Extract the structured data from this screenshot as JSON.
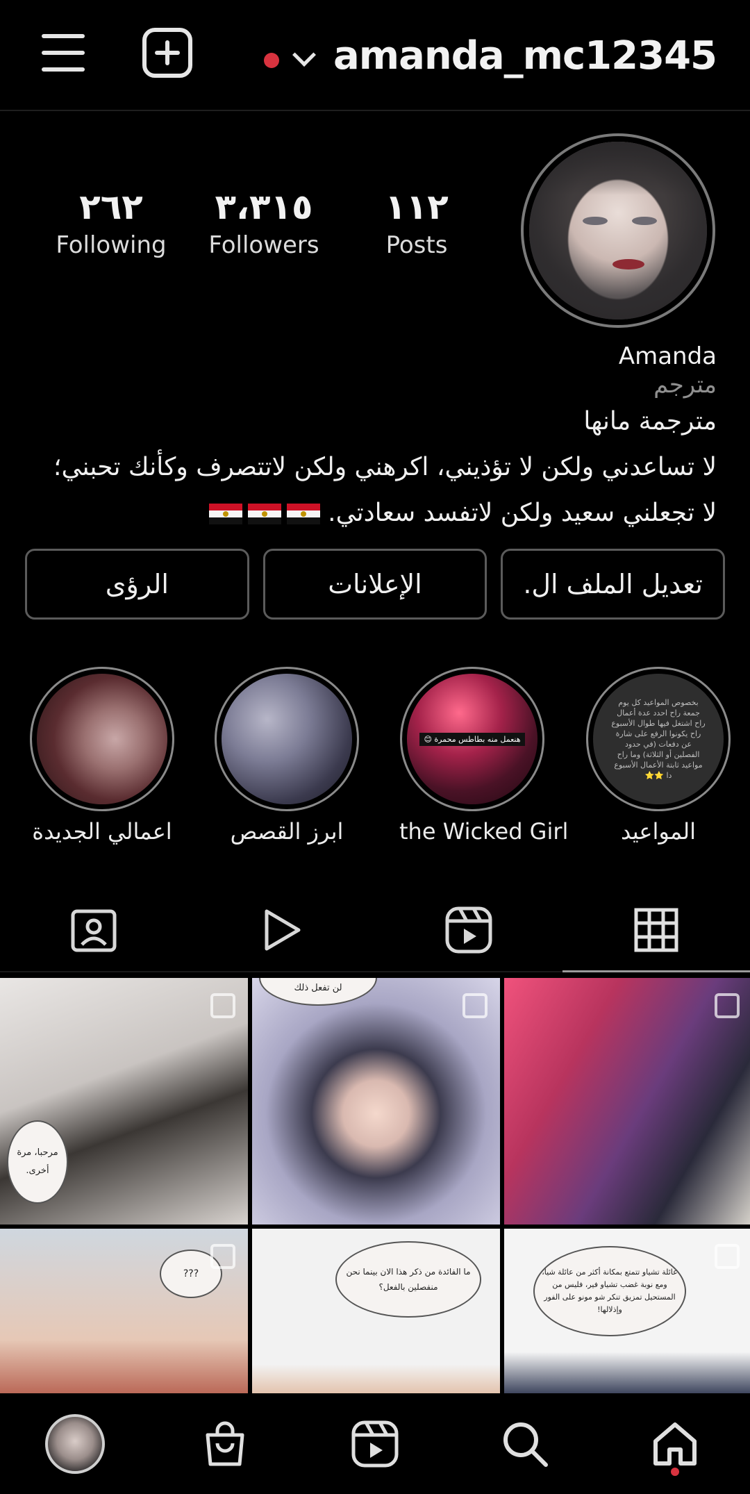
{
  "header": {
    "username": "amanda_mc12345"
  },
  "profile": {
    "stats": [
      {
        "value": "٢٦٢",
        "label": "Following"
      },
      {
        "value": "٣،٣١٥",
        "label": "Followers"
      },
      {
        "value": "١١٢",
        "label": "Posts"
      }
    ],
    "name": "Amanda",
    "category": "مترجم",
    "bio_lines": [
      "مترجمة مانها",
      "لا تساعدني ولكن لا تؤذيني، اكرهني ولكن لاتتصرف وكأنك تحبني؛",
      "لا تجعلني سعيد ولكن لاتفسد سعادتي."
    ]
  },
  "actions": {
    "edit_profile": "تعديل الملف ال.",
    "ads": "الإعلانات",
    "insights": "الرؤى"
  },
  "highlights": [
    {
      "label": "المواعيد",
      "text": "بخصوص المواعيد كل يوم جمعة راح احدد عدة أعمال راح اشتغل فيها طوال الأسبوع راح يكونوا الرفع على شارة عن دفعات (في حدود الفصلين أو الثلاثة) وما راح مواعيد ثابتة الأعمال الأسبوع دا ⭐⭐"
    },
    {
      "label": "the Wicked Girl",
      "text": "هنعمل منه بطاطس محمرة 😊"
    },
    {
      "label": "ابرز القصص"
    },
    {
      "label": "اعمالي الجديدة"
    }
  ],
  "posts": [
    {
      "bubble": "مرحبا، مرة أخرى."
    },
    {
      "bubble": "لن تفعل ذلك"
    },
    {
      "bubble": ""
    },
    {
      "bubble": "???"
    },
    {
      "bubble": "ما الفائدة من ذكر هذا الان بينما نحن منفصلين بالفعل؟"
    },
    {
      "bubble": "عائلة تشياو تتمتع بمكانة أكثر من عائلة شيا، ومع نوبة غضب تشياو فير، فليس من المستحيل تمزيق تنكر شو مونو على الفور وإذلالها!"
    }
  ],
  "icons": {
    "menu": "menu-icon",
    "new_post": "plus-square-icon",
    "account_switch": "chevron-down-icon",
    "tab_tagged": "tagged-icon",
    "tab_videos": "play-icon",
    "tab_reels": "reels-icon",
    "tab_grid": "grid-icon",
    "nav_home": "home-icon",
    "nav_search": "search-icon",
    "nav_reels": "reels-icon",
    "nav_shop": "shop-bag-icon",
    "nav_profile": "avatar"
  },
  "colors": {
    "background": "#000000",
    "notification_dot": "#d8333f",
    "text": "#f2f2f2",
    "muted_text": "#8f8f8f"
  }
}
